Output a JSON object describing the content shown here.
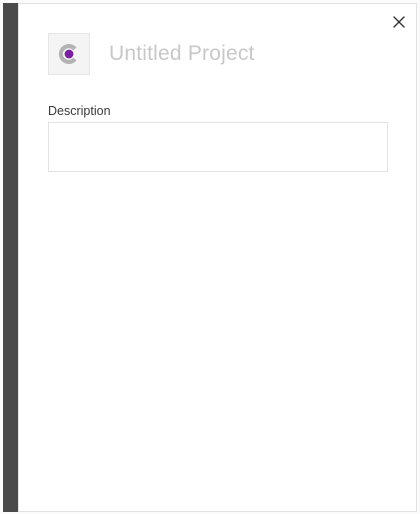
{
  "project": {
    "title": "Untitled Project",
    "logo_icon": "project-logo-icon"
  },
  "description": {
    "label": "Description",
    "value": "",
    "placeholder": ""
  },
  "controls": {
    "close_icon": "close-icon"
  },
  "colors": {
    "accent": "#7a1fa2",
    "sidebar": "#4a4a4a",
    "title_text": "#c8c8c8"
  }
}
